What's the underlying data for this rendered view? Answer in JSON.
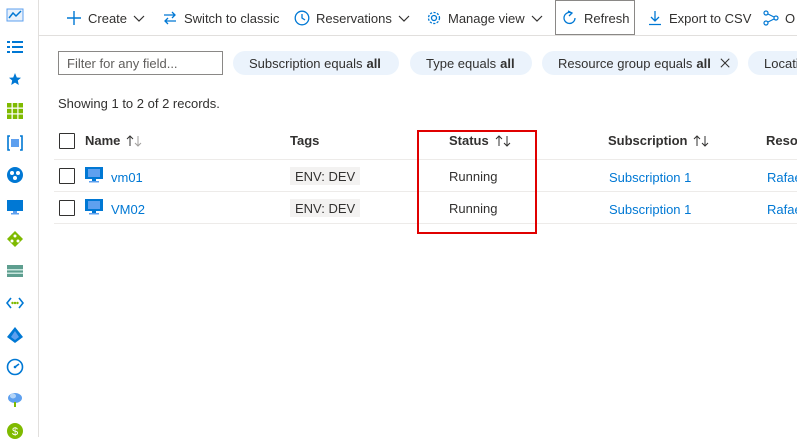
{
  "toolbar": {
    "create_label": "Create",
    "switch_label": "Switch to classic",
    "reservations_label": "Reservations",
    "manage_view_label": "Manage view",
    "refresh_label": "Refresh",
    "export_label": "Export to CSV",
    "open_query_label": "O"
  },
  "filters": {
    "placeholder": "Filter for any field...",
    "pills": [
      {
        "label": "Subscription equals",
        "value": "all"
      },
      {
        "label": "Type equals",
        "value": "all"
      },
      {
        "label": "Resource group equals",
        "value": "all"
      },
      {
        "label": "Locati",
        "value": ""
      }
    ]
  },
  "records_text": "Showing 1 to 2 of 2 records.",
  "columns": {
    "name": "Name",
    "tags": "Tags",
    "status": "Status",
    "subscription": "Subscription",
    "resource_group": "Resou"
  },
  "rows": [
    {
      "name": "vm01",
      "tag": "ENV: DEV",
      "status": "Running",
      "subscription": "Subscription 1",
      "resource_group": "Rafae"
    },
    {
      "name": "VM02",
      "tag": "ENV: DEV",
      "status": "Running",
      "subscription": "Subscription 1",
      "resource_group": "Rafae"
    }
  ],
  "colors": {
    "accent": "#0078d4",
    "highlight": "#e00000",
    "pill_bg": "#ebf3fc"
  },
  "sidebar_icons": [
    "dashboard-icon",
    "all-services-icon",
    "favorites-star-icon",
    "all-resources-icon",
    "resource-groups-icon",
    "app-services-icon",
    "virtual-machines-icon",
    "load-balancers-icon",
    "storage-accounts-icon",
    "virtual-networks-icon",
    "azure-ad-icon",
    "monitor-icon",
    "advisor-icon",
    "cost-management-icon"
  ]
}
